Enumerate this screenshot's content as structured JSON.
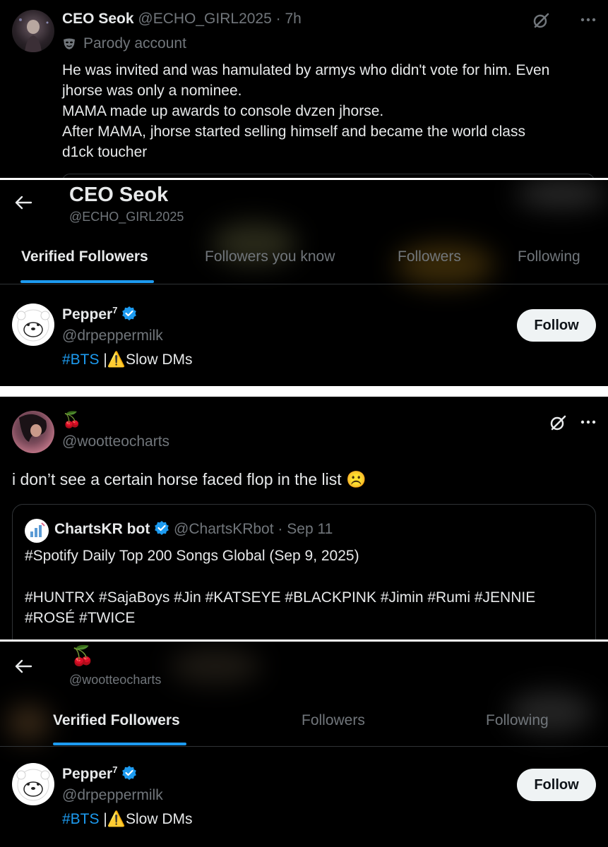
{
  "tweet1": {
    "display_name": "CEO Seok",
    "handle": "@ECHO_GIRL2025",
    "dot": "·",
    "time": "7h",
    "parody_label": "Parody account",
    "text_lines": [
      "He was invited and was hamulated by armys who didn't vote for him. Even",
      "jhorse was only a nominee.",
      "MAMA made up awards to console dvzen jhorse.",
      "After MAMA, jhorse started selling himself and became the world class",
      "d1ck toucher"
    ]
  },
  "profile1": {
    "display_name": "CEO Seok",
    "handle": "@ECHO_GIRL2025",
    "tabs": [
      "Verified Followers",
      "Followers you know",
      "Followers",
      "Following"
    ],
    "active_tab": "Verified Followers"
  },
  "follower1": {
    "name": "Pepper",
    "name_sup": "7",
    "handle": "@drpeppermilk",
    "bio_tag": "#BTS",
    "bio_sep": "|",
    "bio_warning": "⚠️",
    "bio_text": "Slow DMs",
    "follow_label": "Follow"
  },
  "tweet2": {
    "display_name": "🍒",
    "handle": "@wootteocharts",
    "text": "i don’t see a certain horse faced flop in the list",
    "emoji": "☹️",
    "quote": {
      "name": "ChartsKR bot",
      "handle": "@ChartsKRbot",
      "dot": "·",
      "date": "Sep 11",
      "line1": "#Spotify Daily Top 200 Songs Global (Sep 9, 2025)",
      "line2": "#HUNTRX #SajaBoys #Jin #KATSEYE #BLACKPINK #Jimin #Rumi #JENNIE",
      "line3": "#ROSÉ #TWICE"
    }
  },
  "profile2": {
    "display_name": "🍒",
    "handle": "@wootteocharts",
    "tabs": [
      "Verified Followers",
      "Followers",
      "Following"
    ],
    "active_tab": "Verified Followers"
  },
  "follower2": {
    "name": "Pepper",
    "name_sup": "7",
    "handle": "@drpeppermilk",
    "bio_tag": "#BTS",
    "bio_sep": "|",
    "bio_warning": "⚠️",
    "bio_text": "Slow DMs",
    "follow_label": "Follow"
  },
  "icons": {
    "grok": "grok-icon",
    "more": "more-icon",
    "back": "back-arrow-icon",
    "verified": "verified-badge-icon",
    "parody": "mask-icon"
  },
  "colors": {
    "accent": "#1d9bf0",
    "background": "#000000",
    "text": "#e7e9ea",
    "muted": "#71767b",
    "follow_button_bg": "#eff3f4"
  }
}
